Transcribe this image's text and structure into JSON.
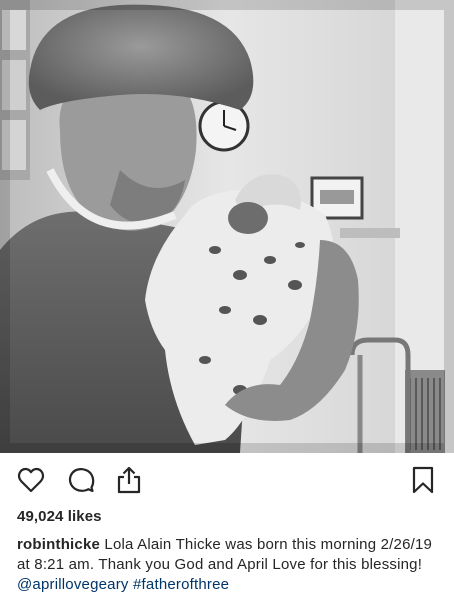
{
  "post": {
    "photo_description_icon": "photo",
    "actions": {
      "like_icon": "heart-outline-icon",
      "comment_icon": "speech-bubble-icon",
      "share_icon": "share-upload-icon",
      "save_icon": "bookmark-outline-icon"
    },
    "likes_text": "49,024 likes",
    "caption": {
      "username": "robinthicke",
      "text": " Lola Alain Thicke was born this morning 2/26/19 at 8:21 am. Thank you God and April Love for this blessing! ",
      "mention": "@aprillovegeary",
      "hashtag": "#fatherofthree"
    }
  },
  "colors": {
    "text": "#262626",
    "link": "#003569",
    "icon": "#262626",
    "background": "#ffffff"
  }
}
